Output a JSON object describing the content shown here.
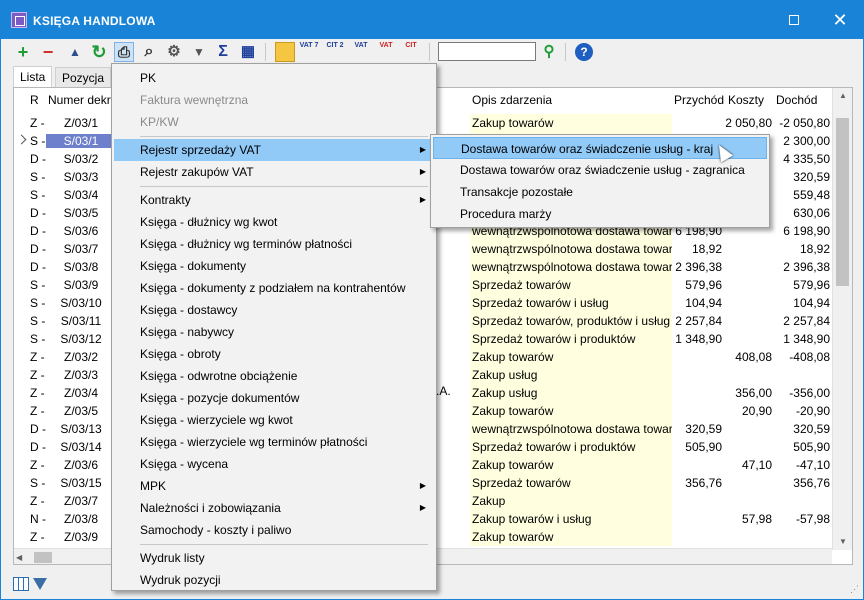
{
  "window": {
    "title": "KSIĘGA HANDLOWA",
    "maximize_label": "☐",
    "close_label": "✕"
  },
  "toolbar": {
    "add": "+",
    "remove": "−",
    "up": "▲",
    "refresh": "↻",
    "print": "⎙",
    "find": "⌕",
    "settings": "⚙",
    "filter": "▼",
    "sum": "Σ",
    "table": "▦",
    "vat7_label": "VAT 7",
    "cit2_label": "CIT 2",
    "vat_label": "VAT",
    "vat2_label": "VAT",
    "cit_label": "CIT",
    "help": "?"
  },
  "tabs": [
    {
      "label": "Lista"
    },
    {
      "label": "Pozycja"
    }
  ],
  "columns": {
    "r": "R",
    "number": "Numer dekr.",
    "description": "Opis zdarzenia",
    "income_rev": "Przychód",
    "costs": "Koszty",
    "income": "Dochód"
  },
  "rows": [
    {
      "r": "Z -",
      "num": "Z/03/1",
      "desc": "Zakup towarów",
      "in": "",
      "cost": "2 050,80",
      "inc": "-2 050,80"
    },
    {
      "r": "S -",
      "num": "S/03/1",
      "desc": "",
      "in": "",
      "cost": "",
      "inc": "2 300,00"
    },
    {
      "r": "D -",
      "num": "S/03/2",
      "desc": "",
      "in": "",
      "cost": "",
      "inc": "4 335,50"
    },
    {
      "r": "S -",
      "num": "S/03/3",
      "desc": "",
      "in": "",
      "cost": "",
      "inc": "320,59"
    },
    {
      "r": "S -",
      "num": "S/03/4",
      "desc": "",
      "in": "",
      "cost": "",
      "inc": "559,48"
    },
    {
      "r": "D -",
      "num": "S/03/5",
      "desc": "",
      "in": "",
      "cost": "",
      "inc": "630,06"
    },
    {
      "r": "D -",
      "num": "S/03/6",
      "desc": "wewnątrzwspólnotowa dostawa towarów",
      "in": "6 198,90",
      "cost": "",
      "inc": "6 198,90"
    },
    {
      "r": "D -",
      "num": "S/03/7",
      "desc": "wewnątrzwspólnotowa dostawa towarów",
      "in": "18,92",
      "cost": "",
      "inc": "18,92"
    },
    {
      "r": "D -",
      "num": "S/03/8",
      "desc": "wewnątrzwspólnotowa dostawa towarów",
      "in": "2 396,38",
      "cost": "",
      "inc": "2 396,38"
    },
    {
      "r": "S -",
      "num": "S/03/9",
      "desc": "Sprzedaż towarów",
      "in": "579,96",
      "cost": "",
      "inc": "579,96"
    },
    {
      "r": "S -",
      "num": "S/03/10",
      "desc": "Sprzedaż towarów i usług",
      "in": "104,94",
      "cost": "",
      "inc": "104,94"
    },
    {
      "r": "S -",
      "num": "S/03/11",
      "desc": "Sprzedaż towarów, produktów i usług",
      "in": "2 257,84",
      "cost": "",
      "inc": "2 257,84"
    },
    {
      "r": "S -",
      "num": "S/03/12",
      "desc": "Sprzedaż towarów i produktów",
      "in": "1 348,90",
      "cost": "",
      "inc": "1 348,90"
    },
    {
      "r": "Z -",
      "num": "Z/03/2",
      "desc": "Zakup towarów",
      "in": "",
      "cost": "408,08",
      "inc": "-408,08"
    },
    {
      "r": "Z -",
      "num": "Z/03/3",
      "desc": "Zakup usług",
      "in": "",
      "cost": "",
      "inc": ""
    },
    {
      "r": "Z -",
      "num": "Z/03/4",
      "desc": "Zakup usług",
      "in": "",
      "cost": "356,00",
      "inc": "-356,00"
    },
    {
      "r": "Z -",
      "num": "Z/03/5",
      "desc": "Zakup towarów",
      "in": "",
      "cost": "20,90",
      "inc": "-20,90"
    },
    {
      "r": "D -",
      "num": "S/03/13",
      "desc": "wewnątrzwspólnotowa dostawa towarów",
      "in": "320,59",
      "cost": "",
      "inc": "320,59"
    },
    {
      "r": "D -",
      "num": "S/03/14",
      "desc": "Sprzedaż towarów i produktów",
      "in": "505,90",
      "cost": "",
      "inc": "505,90"
    },
    {
      "r": "Z -",
      "num": "Z/03/6",
      "desc": "Zakup towarów",
      "in": "",
      "cost": "47,10",
      "inc": "-47,10"
    },
    {
      "r": "S -",
      "num": "S/03/15",
      "desc": "Sprzedaż towarów",
      "in": "356,76",
      "cost": "",
      "inc": "356,76"
    },
    {
      "r": "Z -",
      "num": "Z/03/7",
      "desc": "Zakup",
      "in": "",
      "cost": "",
      "inc": ""
    },
    {
      "r": "N -",
      "num": "Z/03/8",
      "desc": "Zakup towarów i usług",
      "in": "",
      "cost": "57,98",
      "inc": "-57,98"
    },
    {
      "r": "Z -",
      "num": "Z/03/9",
      "desc": "Zakup towarów",
      "in": "",
      "cost": "",
      "inc": ""
    }
  ],
  "partial_contractor": "IA S.A.",
  "print_menu": {
    "items": [
      {
        "label": "PK",
        "disabled": false,
        "submenu": false
      },
      {
        "label": "Faktura wewnętrzna",
        "disabled": true,
        "submenu": false
      },
      {
        "label": "KP/KW",
        "disabled": true,
        "submenu": false
      },
      {
        "label": "Rejestr sprzedaży VAT",
        "disabled": false,
        "submenu": true,
        "hover": true
      },
      {
        "label": "Rejestr zakupów VAT",
        "disabled": false,
        "submenu": true
      },
      {
        "label": "Kontrakty",
        "disabled": false,
        "submenu": true
      },
      {
        "label": "Księga - dłużnicy wg kwot",
        "disabled": false,
        "submenu": false
      },
      {
        "label": "Księga - dłużnicy wg terminów płatności",
        "disabled": false,
        "submenu": false
      },
      {
        "label": "Księga - dokumenty",
        "disabled": false,
        "submenu": false
      },
      {
        "label": "Księga - dokumenty z podziałem na kontrahentów",
        "disabled": false,
        "submenu": false
      },
      {
        "label": "Księga - dostawcy",
        "disabled": false,
        "submenu": false
      },
      {
        "label": "Księga - nabywcy",
        "disabled": false,
        "submenu": false
      },
      {
        "label": "Księga - obroty",
        "disabled": false,
        "submenu": false
      },
      {
        "label": "Księga - odwrotne obciążenie",
        "disabled": false,
        "submenu": false
      },
      {
        "label": "Księga - pozycje dokumentów",
        "disabled": false,
        "submenu": false
      },
      {
        "label": "Księga - wierzyciele wg kwot",
        "disabled": false,
        "submenu": false
      },
      {
        "label": "Księga - wierzyciele wg terminów płatności",
        "disabled": false,
        "submenu": false
      },
      {
        "label": "Księga - wycena",
        "disabled": false,
        "submenu": false
      },
      {
        "label": "MPK",
        "disabled": false,
        "submenu": true
      },
      {
        "label": "Należności i zobowiązania",
        "disabled": false,
        "submenu": true
      },
      {
        "label": "Samochody - koszty i paliwo",
        "disabled": false,
        "submenu": false
      },
      {
        "label": "Wydruk listy",
        "disabled": false,
        "submenu": false
      },
      {
        "label": "Wydruk pozycji",
        "disabled": false,
        "submenu": false
      }
    ]
  },
  "vat_submenu": {
    "items": [
      {
        "label": "Dostawa towarów oraz świadczenie usług - kraj",
        "hover": true
      },
      {
        "label": "Dostawa towarów oraz świadczenie usług - zagranica"
      },
      {
        "label": "Transakcje pozostałe"
      },
      {
        "label": "Procedura marży"
      }
    ]
  },
  "colors": {
    "titlebar": "#1883d7",
    "selection": "#6e7fcc",
    "menu_hover": "#91c9f7",
    "description_bg": "#ffffe0"
  }
}
